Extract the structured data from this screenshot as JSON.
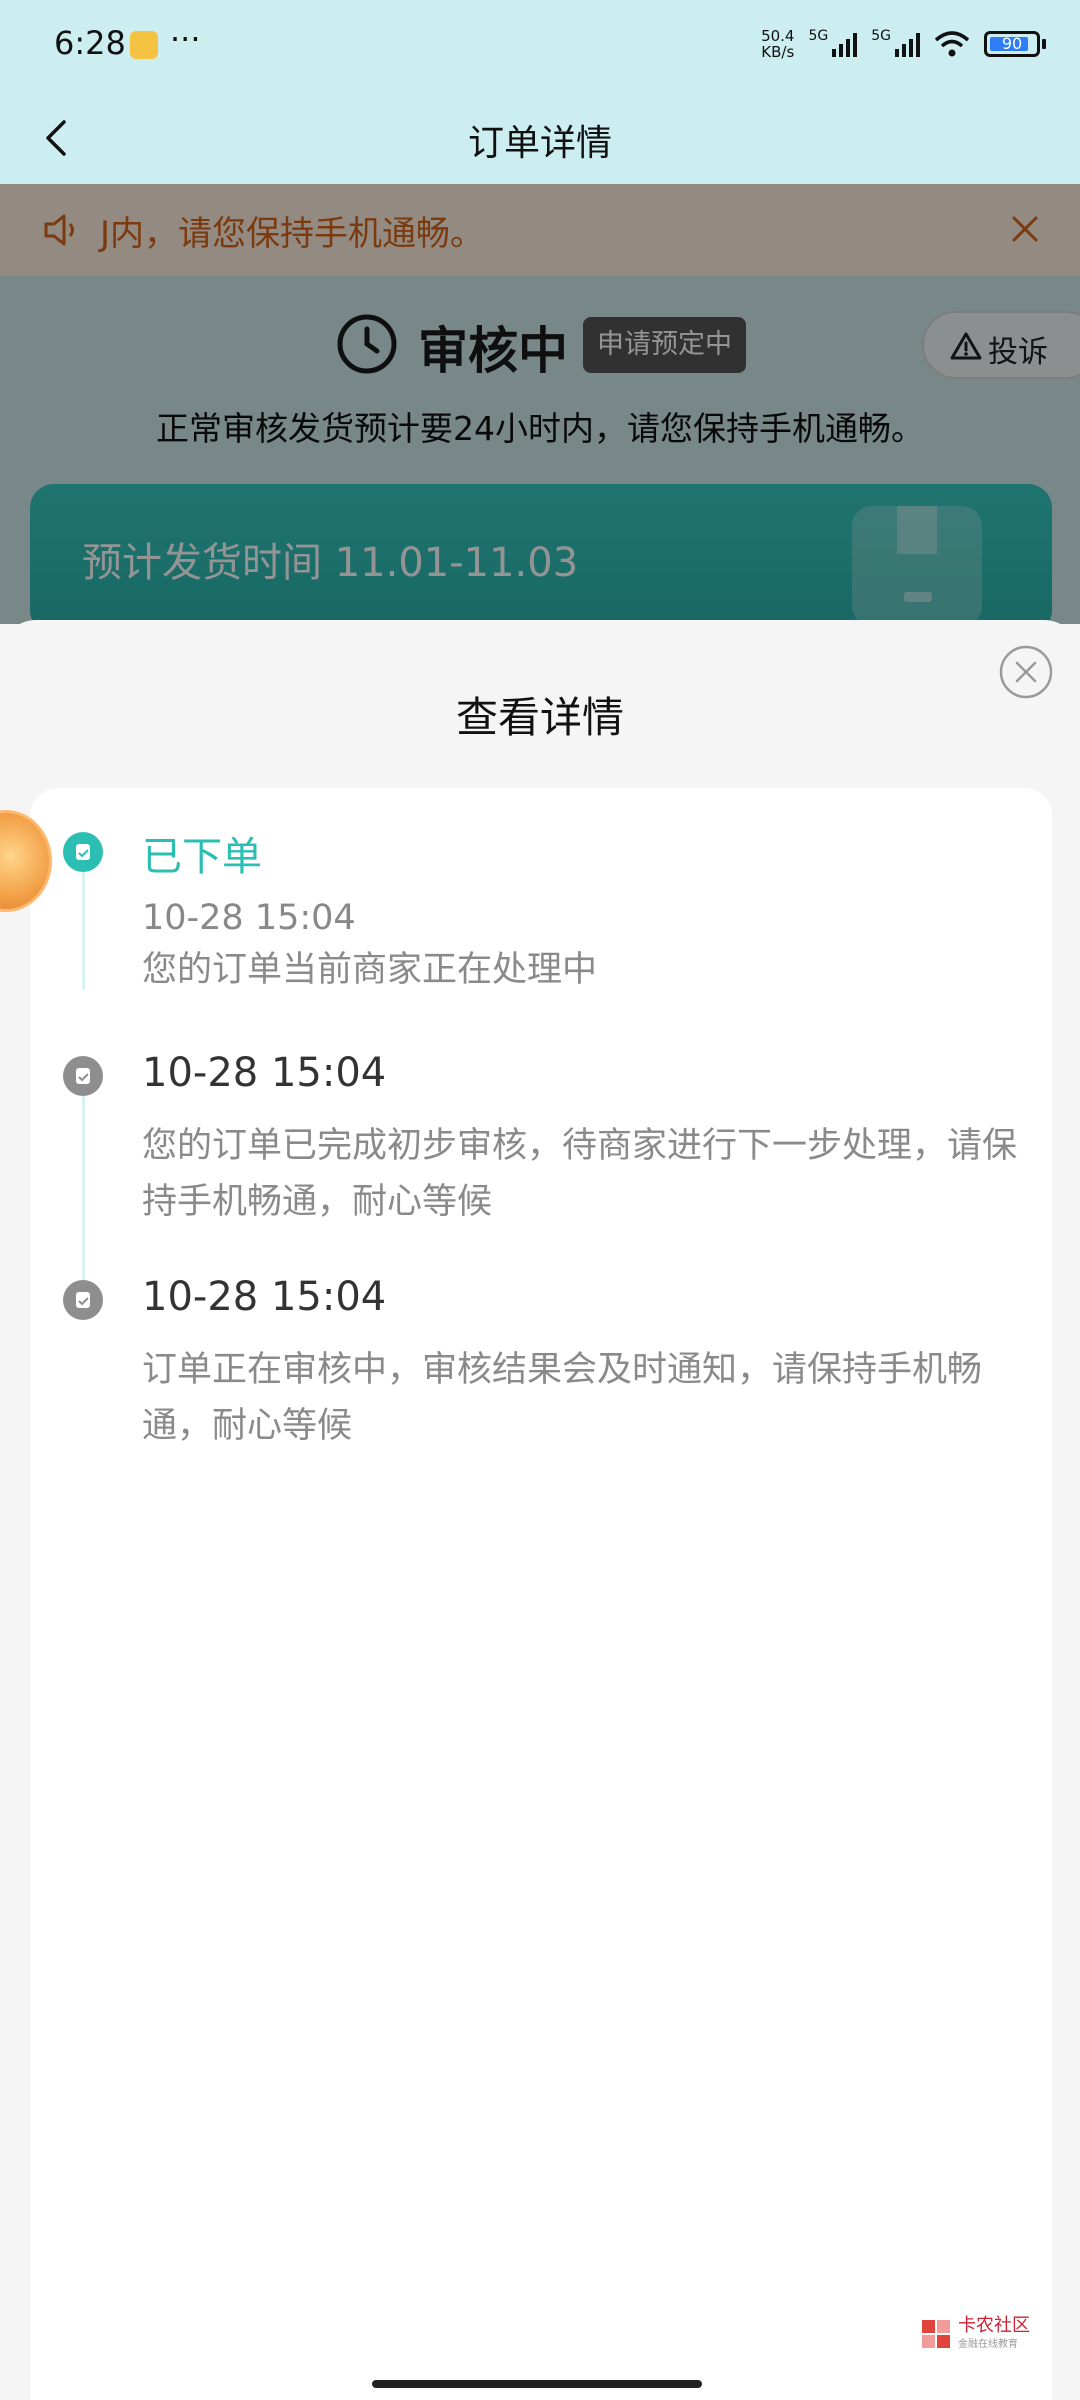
{
  "status_bar": {
    "time": "6:28",
    "speed": "50.4\nKB/s",
    "network": [
      "5G",
      "5G"
    ],
    "battery": "90"
  },
  "header": {
    "title": "订单详情"
  },
  "notice": {
    "text": "J内，请您保持手机通畅。"
  },
  "order_status": {
    "title": "审核中",
    "tag": "申请预定中",
    "complain": "投诉",
    "description": "正常审核发货预计要24小时内，请您保持手机通畅。"
  },
  "shipping": {
    "text": "预计发货时间 11.01-11.03"
  },
  "sheet": {
    "title": "查看详情",
    "timeline": [
      {
        "title": "已下单",
        "time": "10-28 15:04",
        "desc": "您的订单当前商家正在处理中",
        "active": true
      },
      {
        "time": "10-28 15:04",
        "desc": "您的订单已完成初步审核，待商家进行下一步处理，请保持手机畅通，耐心等候",
        "active": false
      },
      {
        "time": "10-28 15:04",
        "desc": "订单正在审核中，审核结果会及时通知，请保持手机畅通，耐心等候",
        "active": false
      }
    ]
  },
  "watermark": {
    "name": "卡农社区",
    "sub": "金融在线教育"
  },
  "colors": {
    "accent": "#2bbfb3",
    "notice_text": "#d4651b",
    "header_bg": "#cdeef0"
  }
}
